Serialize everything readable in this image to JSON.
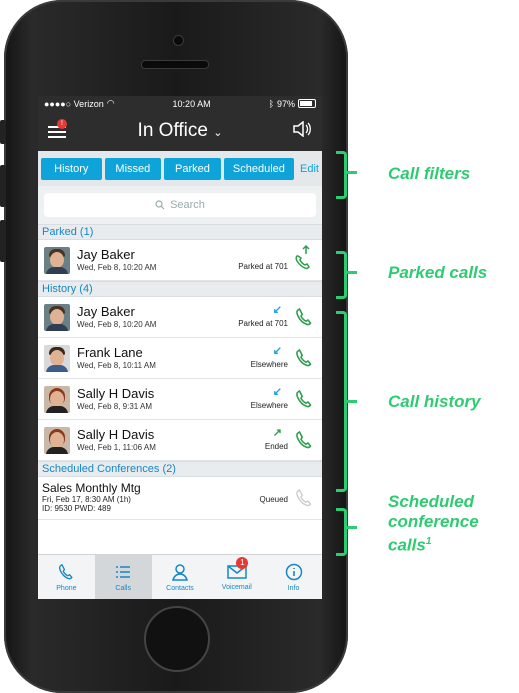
{
  "status_bar": {
    "carrier": "●●●●○ Verizon",
    "time": "10:20 AM",
    "battery": "97%"
  },
  "header": {
    "menu_badge": "!",
    "title": "In Office",
    "chevron": "⌄"
  },
  "filters": [
    "History",
    "Missed",
    "Parked",
    "Scheduled"
  ],
  "edit_label": "Edit",
  "search": {
    "placeholder": "Search"
  },
  "sections": {
    "parked": "Parked (1)",
    "history": "History (4)",
    "scheduled": "Scheduled Conferences (2)"
  },
  "parked_calls": [
    {
      "name": "Jay Baker",
      "date": "Wed, Feb 8, 10:20 AM",
      "status": "Parked at 701"
    }
  ],
  "history_calls": [
    {
      "name": "Jay Baker",
      "date": "Wed, Feb 8, 10:20 AM",
      "status": "Parked at 701",
      "direction": "↙"
    },
    {
      "name": "Frank Lane",
      "date": "Wed, Feb 8, 10:11 AM",
      "status": "Elsewhere",
      "direction": "↙"
    },
    {
      "name": "Sally H Davis",
      "date": "Wed, Feb 8, 9:31 AM",
      "status": "Elsewhere",
      "direction": "↙"
    },
    {
      "name": "Sally H Davis",
      "date": "Wed, Feb 1, 11:06 AM",
      "status": "Ended",
      "direction": "↗"
    }
  ],
  "conference": {
    "title": "Sales Monthly Mtg",
    "time": "Fri, Feb 17, 8:30 AM (1h)",
    "ids": "ID: 9530   PWD: 489",
    "status": "Queued"
  },
  "tabs": [
    {
      "label": "Phone",
      "icon": "phone-icon"
    },
    {
      "label": "Calls",
      "icon": "list-icon"
    },
    {
      "label": "Contacts",
      "icon": "person-icon"
    },
    {
      "label": "Voicemail",
      "icon": "envelope-icon",
      "badge": "1"
    },
    {
      "label": "Info",
      "icon": "info-icon"
    }
  ],
  "callouts": {
    "filters": "Call filters",
    "parked": "Parked calls",
    "history": "Call history",
    "scheduled_1": "Scheduled",
    "scheduled_2": "conference",
    "scheduled_3": "calls",
    "footnote": "1"
  },
  "colors": {
    "accent": "#0fa4d9",
    "call_green": "#2e9e4f",
    "callout_green": "#2ecc71",
    "header_bg": "#2d2d2d"
  }
}
